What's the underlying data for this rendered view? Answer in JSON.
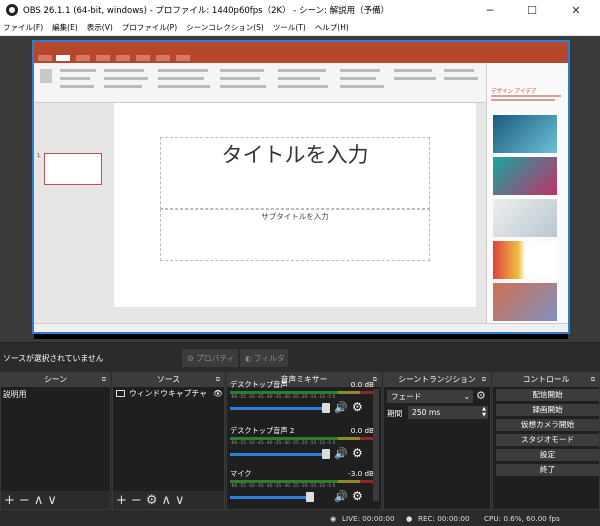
{
  "window": {
    "title": "OBS 26.1.1 (64-bit, windows) - プロファイル: 1440p60fps（2K） - シーン: 解説用（予備）",
    "minimize": "─",
    "maximize": "☐",
    "close": "✕"
  },
  "menu": [
    "ファイル(F)",
    "編集(E)",
    "表示(V)",
    "プロファイル(P)",
    "シーンコレクション(S)",
    "ツール(T)",
    "ヘルプ(H)"
  ],
  "preview": {
    "slide_title": "タイトルを入力",
    "slide_subtitle": "サブタイトルを入力",
    "slide_number": "1",
    "design_heading": "デザイン アイデア"
  },
  "source_bar": {
    "no_selection": "ソースが選択されていません",
    "properties": "プロパティ",
    "filters": "フィルタ"
  },
  "docks": {
    "scenes": {
      "title": "シーン",
      "items": [
        "説明用"
      ]
    },
    "sources": {
      "title": "ソース",
      "items": [
        "ウィンドウキャプチャ"
      ]
    },
    "mixer": {
      "title": "音声ミキサー",
      "ticks": "-60 -55 -50 -45 -40 -35 -30 -25 -20 -15 -10 -5 0",
      "channels": [
        {
          "name": "デスクトップ音声",
          "db": "0.0 dB",
          "level": 0.95
        },
        {
          "name": "デスクトップ音声 2",
          "db": "0.0 dB",
          "level": 0.95
        },
        {
          "name": "マイク",
          "db": "-3.0 dB",
          "level": 0.88
        }
      ]
    },
    "transitions": {
      "title": "シーントランジション",
      "type": "フェード",
      "duration_label": "期間",
      "duration": "250 ms"
    },
    "controls": {
      "title": "コントロール",
      "buttons": [
        "配信開始",
        "録画開始",
        "仮想カメラ開始",
        "スタジオモード",
        "設定",
        "終了"
      ]
    }
  },
  "footer_icons": {
    "add": "+",
    "remove": "−",
    "up": "∧",
    "down": "∨",
    "gear": "⚙"
  },
  "status": {
    "live": "LIVE: 00:00:00",
    "rec": "REC: 00:00:00",
    "cpu": "CPU: 0.6%, 60.00 fps"
  },
  "colors": {
    "ppt_accent": "#b7472a",
    "selection": "#2a7fd4",
    "meter_green": "#2e7d2e",
    "slider": "#2a82da"
  }
}
